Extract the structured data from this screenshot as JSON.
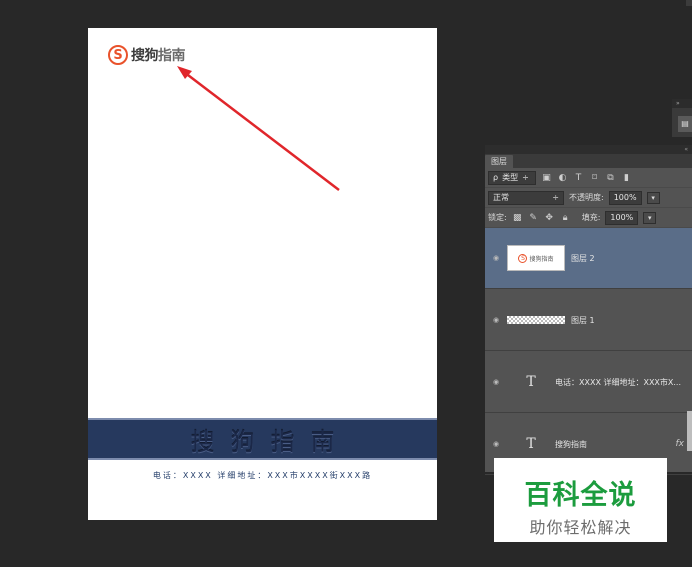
{
  "document": {
    "logo_glyph": "S",
    "logo_text_strong": "搜狗",
    "logo_text": "指南",
    "banner_text": "搜狗指南",
    "footer_text": "电话：XXXX  详细地址：XXX市XXXX街XXX路",
    "arrow_color": "#e0262b"
  },
  "layers_panel": {
    "tab_label": "图层",
    "filter": {
      "search_glyph": "ρ",
      "label": "类型",
      "arrow": "÷"
    },
    "filter_icons": [
      "image-filter-icon",
      "adjustment-filter-icon",
      "type-filter-icon",
      "shape-filter-icon",
      "smart-object-filter-icon",
      "filter-toggle-icon"
    ],
    "blend_mode": "正常",
    "blend_arrow": "÷",
    "opacity_label": "不透明度:",
    "opacity_value": "100%",
    "lock_label": "锁定:",
    "fill_label": "填充:",
    "fill_value": "100%",
    "layers": [
      {
        "name": "图层 2",
        "kind": "image",
        "selected": true
      },
      {
        "name": "图层 1",
        "kind": "texture",
        "selected": false
      },
      {
        "name": "电话：XXXX 详细地址：XXX市X...",
        "kind": "text",
        "selected": false
      },
      {
        "name": "搜狗指南",
        "kind": "text",
        "fx": "fx",
        "selected": false
      }
    ]
  },
  "watermark": {
    "title": "百科全说",
    "subtitle": "助你轻松解决"
  }
}
